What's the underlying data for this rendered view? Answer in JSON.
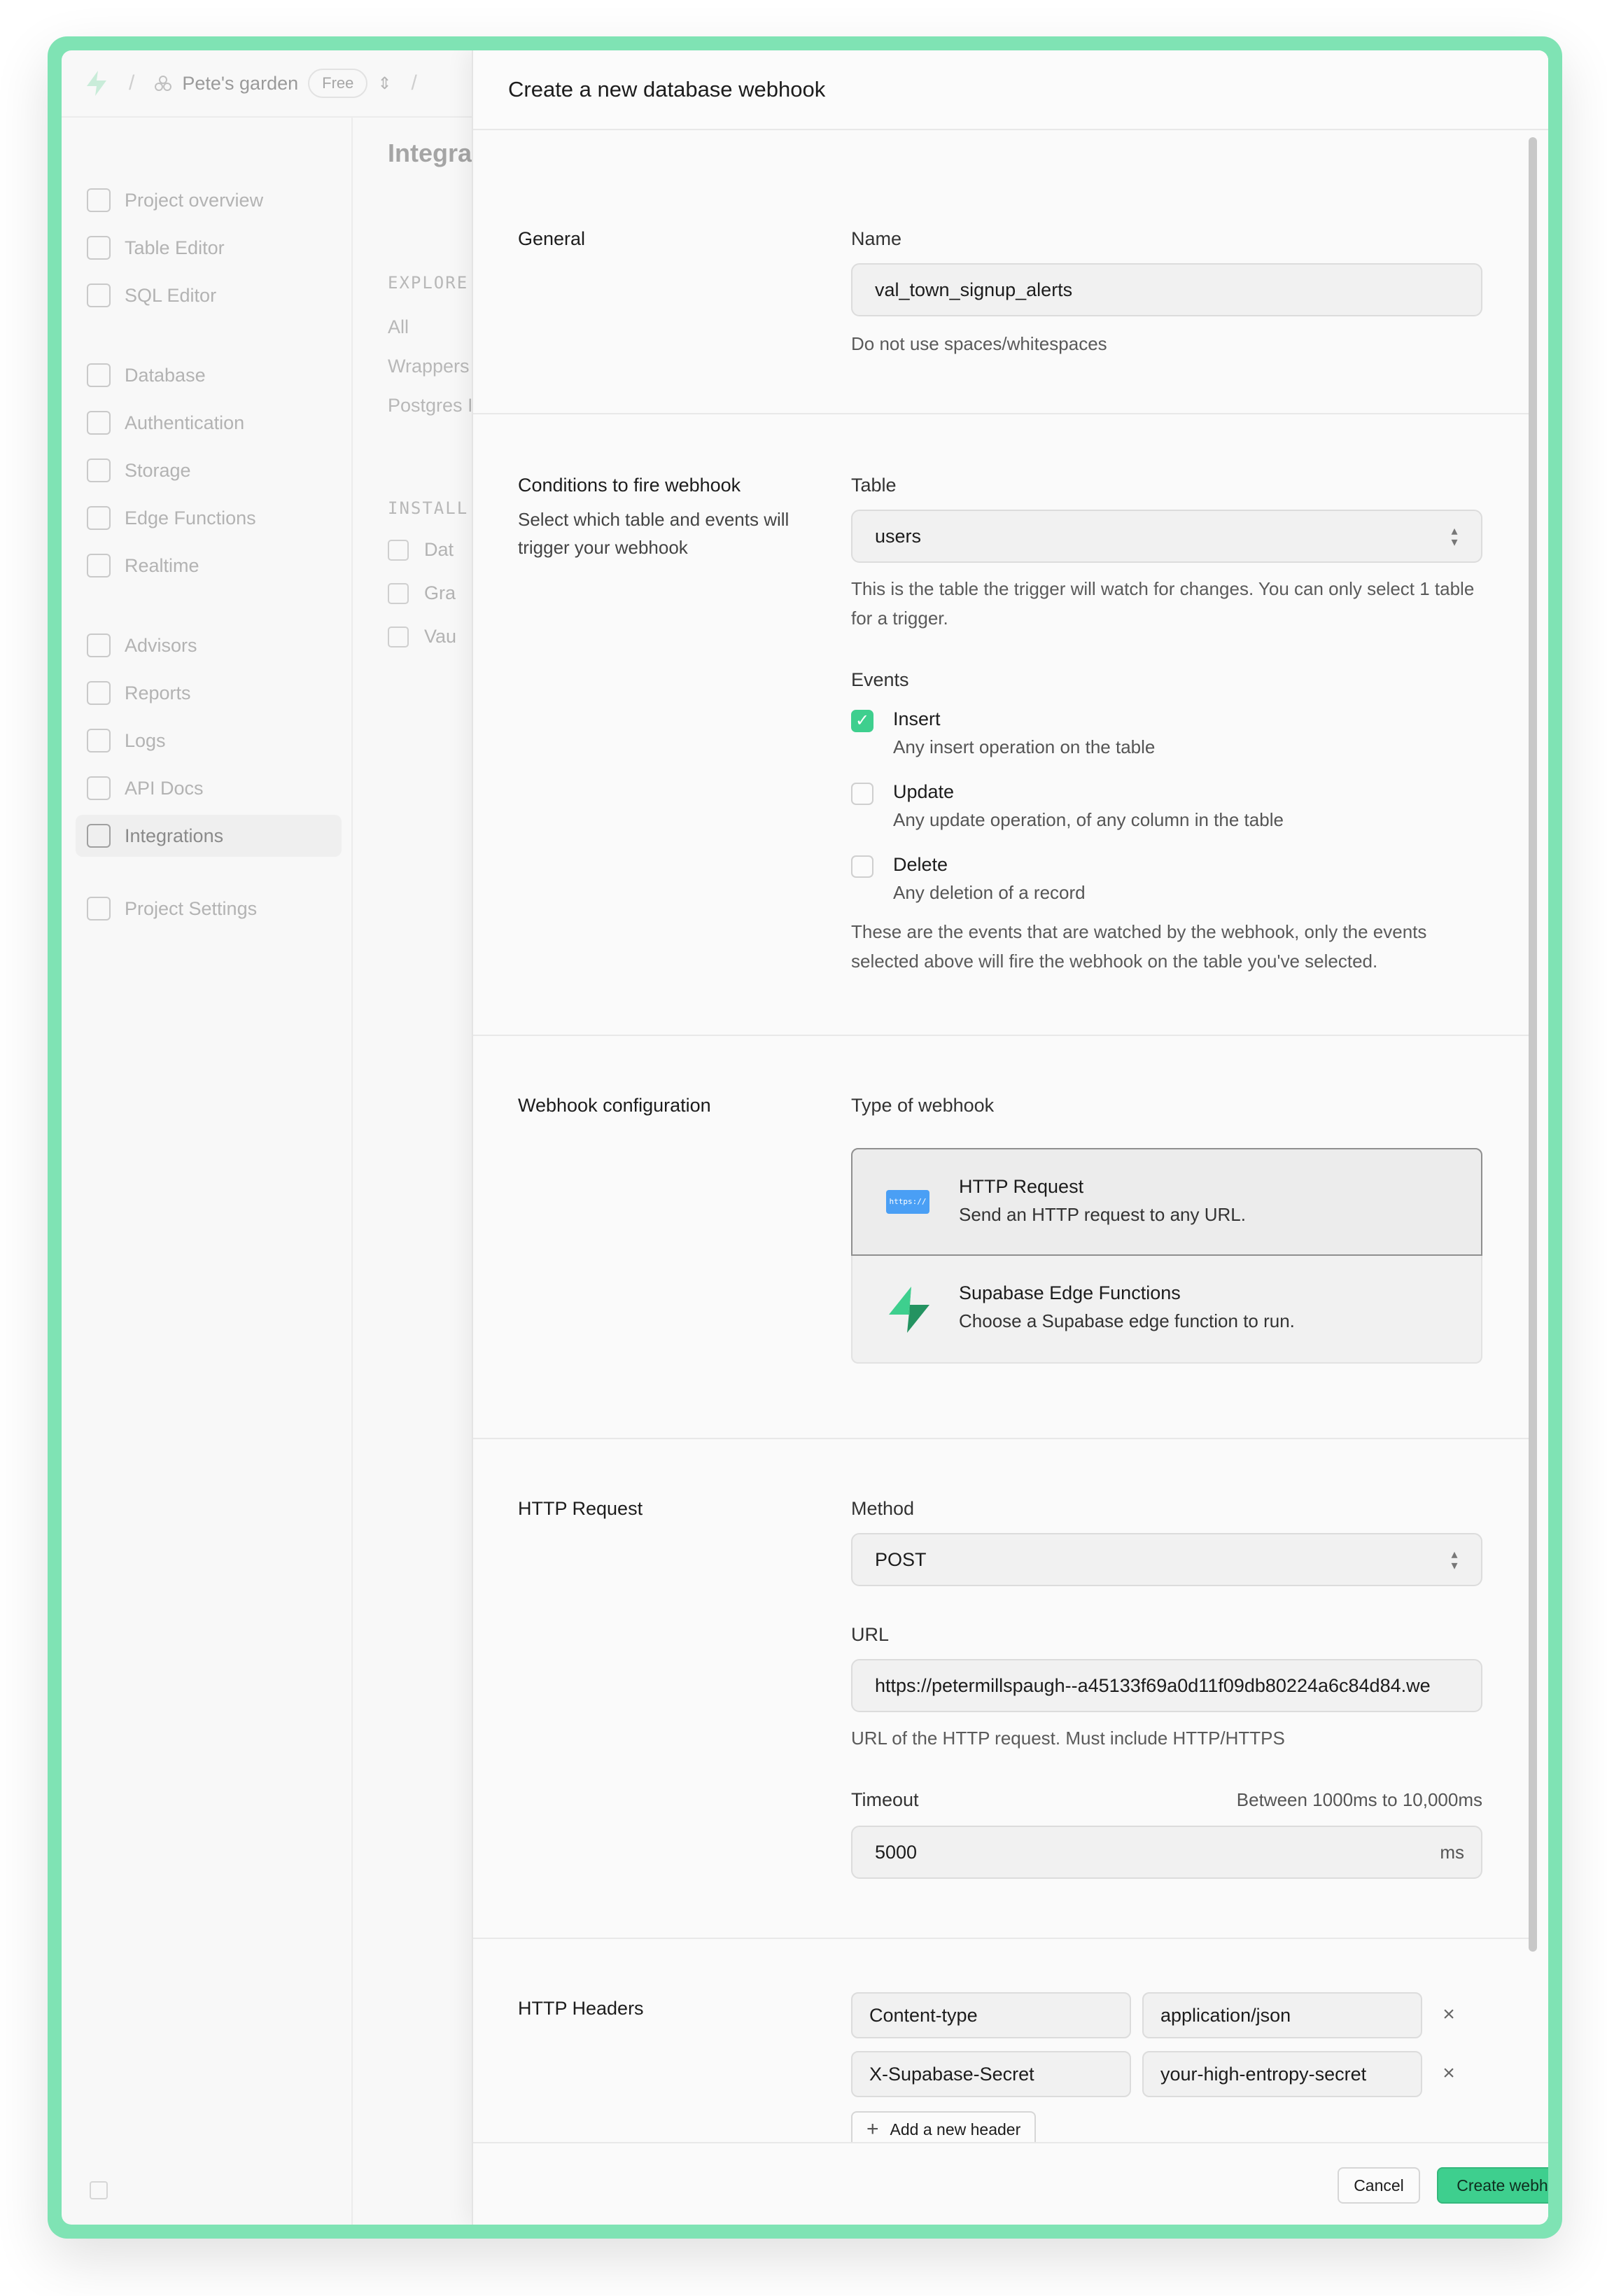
{
  "topbar": {
    "org_name": "Pete's garden",
    "plan_badge": "Free"
  },
  "sidebar": {
    "items": [
      {
        "label": "Project overview",
        "icon": "home-icon"
      },
      {
        "label": "Table Editor",
        "icon": "table-icon"
      },
      {
        "label": "SQL Editor",
        "icon": "terminal-icon"
      },
      {
        "label": "Database",
        "icon": "database-icon"
      },
      {
        "label": "Authentication",
        "icon": "lock-icon"
      },
      {
        "label": "Storage",
        "icon": "archive-icon"
      },
      {
        "label": "Edge Functions",
        "icon": "globe-icon"
      },
      {
        "label": "Realtime",
        "icon": "pointer-icon"
      },
      {
        "label": "Advisors",
        "icon": "lightbulb-icon"
      },
      {
        "label": "Reports",
        "icon": "chart-icon"
      },
      {
        "label": "Logs",
        "icon": "list-icon"
      },
      {
        "label": "API Docs",
        "icon": "file-icon"
      },
      {
        "label": "Integrations",
        "icon": "blocks-icon"
      },
      {
        "label": "Project Settings",
        "icon": "gear-icon"
      }
    ]
  },
  "subnav": {
    "title": "Integrat",
    "explore_label": "EXPLORE",
    "links": [
      "All",
      "Wrappers",
      "Postgres I"
    ],
    "installed_label": "INSTALL",
    "installed": [
      "Dat",
      "Gra",
      "Vau"
    ]
  },
  "panel": {
    "title": "Create a new database webhook",
    "general": {
      "title": "General",
      "name_label": "Name",
      "name_value": "val_town_signup_alerts",
      "name_help": "Do not use spaces/whitespaces"
    },
    "conditions": {
      "title": "Conditions to fire webhook",
      "description": "Select which table and events will trigger your webhook",
      "table_label": "Table",
      "table_value": "users",
      "table_help": "This is the table the trigger will watch for changes. You can only select 1 table for a trigger.",
      "events_label": "Events",
      "events": [
        {
          "name": "Insert",
          "description": "Any insert operation on the table",
          "checked": true
        },
        {
          "name": "Update",
          "description": "Any update operation, of any column in the table",
          "checked": false
        },
        {
          "name": "Delete",
          "description": "Any deletion of a record",
          "checked": false
        }
      ],
      "events_help": "These are the events that are watched by the webhook, only the events selected above will fire the webhook on the table you've selected."
    },
    "webhook_config": {
      "title": "Webhook configuration",
      "type_label": "Type of webhook",
      "types": [
        {
          "name": "HTTP Request",
          "description": "Send an HTTP request to any URL.",
          "icon_text": "https://",
          "selected": true
        },
        {
          "name": "Supabase Edge Functions",
          "description": "Choose a Supabase edge function to run.",
          "selected": false
        }
      ]
    },
    "http_request": {
      "title": "HTTP Request",
      "method_label": "Method",
      "method_value": "POST",
      "url_label": "URL",
      "url_value": "https://petermillspaugh--a45133f69a0d11f09db80224a6c84d84.we",
      "url_help": "URL of the HTTP request. Must include HTTP/HTTPS",
      "timeout_label": "Timeout",
      "timeout_hint": "Between 1000ms to 10,000ms",
      "timeout_value": "5000",
      "timeout_unit": "ms"
    },
    "http_headers": {
      "title": "HTTP Headers",
      "headers": [
        {
          "key": "Content-type",
          "value": "application/json"
        },
        {
          "key": "X-Supabase-Secret",
          "value": "your-high-entropy-secret"
        }
      ],
      "add_label": "Add a new header"
    },
    "footer": {
      "cancel_label": "Cancel",
      "create_label": "Create webhook"
    }
  },
  "colors": {
    "brand": "#3ecf8e",
    "frame": "#7fe3b4",
    "http_icon": "#4a9ff5"
  }
}
